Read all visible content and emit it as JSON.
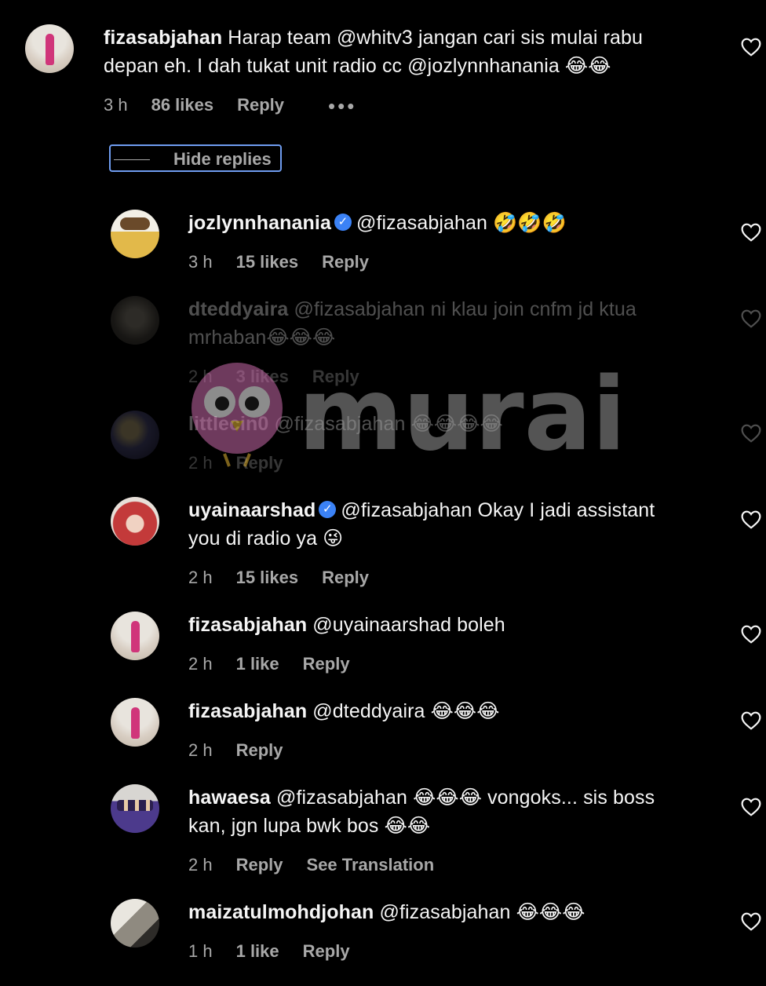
{
  "comments": [
    {
      "username": "fizasabjahan",
      "text_line1": "Harap team @whitv3 jangan cari sis mulai rabu",
      "text_line2": "depan eh. I dah tukat unit radio cc @jozlynnhanania 😂😂",
      "time": "3 h",
      "likes": "86 likes",
      "reply": "Reply",
      "more": "•••"
    },
    {
      "username": "jozlynnhanania",
      "verified": true,
      "text": "@fizasabjahan 🤣🤣🤣",
      "time": "3 h",
      "likes": "15 likes",
      "reply": "Reply"
    },
    {
      "username": "dteddyaira",
      "text_line1": "@fizasabjahan ni klau join cnfm jd ktua",
      "text_line2": "mrhaban😂😂😂",
      "time": "2 h",
      "likes": "3 likes",
      "reply": "Reply"
    },
    {
      "username": "littlecin0",
      "text": "@fizasabjahan 😂😂😂😂",
      "time": "2 h",
      "reply": "Reply"
    },
    {
      "username": "uyainaarshad",
      "verified": true,
      "text_line1": "@fizasabjahan Okay I jadi assistant",
      "text_line2": "you di radio ya 😜",
      "time": "2 h",
      "likes": "15 likes",
      "reply": "Reply"
    },
    {
      "username": "fizasabjahan",
      "text": "@uyainaarshad boleh",
      "time": "2 h",
      "likes": "1 like",
      "reply": "Reply"
    },
    {
      "username": "fizasabjahan",
      "text": "@dteddyaira 😂😂😂",
      "time": "2 h",
      "reply": "Reply"
    },
    {
      "username": "hawaesa",
      "text_line1": "@fizasabjahan 😂😂😂 vongoks... sis boss",
      "text_line2": "kan, jgn lupa bwk bos 😂😂",
      "time": "2 h",
      "reply": "Reply",
      "translate": "See Translation"
    },
    {
      "username": "maizatulmohdjohan",
      "text": "@fizasabjahan 😂😂😂",
      "time": "1 h",
      "likes": "1 like",
      "reply": "Reply"
    }
  ],
  "hide_replies_label": "Hide replies",
  "watermark_text": "murai",
  "colors": {
    "background": "#000000",
    "text": "#f5f5f5",
    "meta": "#a8a8a8",
    "verified": "#3b82f6",
    "focus_outline": "#6f9cf0",
    "watermark_pink": "#d07ab8"
  },
  "icons": [
    "heart-icon",
    "verified-badge-icon",
    "more-options-icon",
    "murai-bird-logo"
  ]
}
